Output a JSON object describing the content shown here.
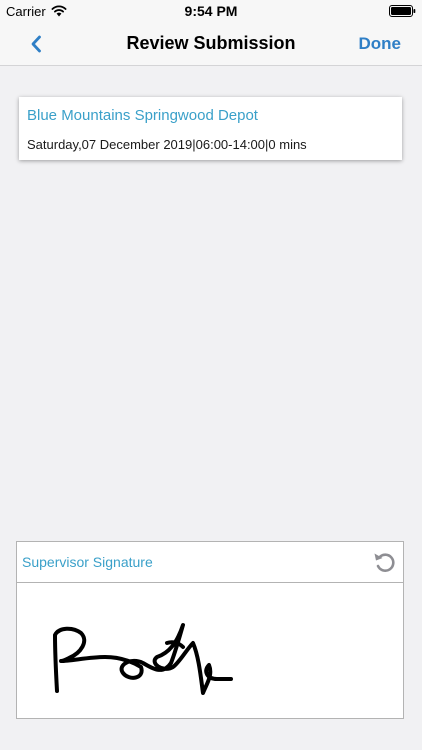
{
  "status_bar": {
    "carrier": "Carrier",
    "time": "9:54 PM",
    "wifi_icon": "wifi-icon",
    "battery_icon": "battery-full-icon"
  },
  "nav": {
    "back_icon": "chevron-left-icon",
    "title": "Review Submission",
    "done_label": "Done"
  },
  "shift": {
    "location": "Blue Mountains Springwood Depot",
    "details": "Saturday,07 December 2019|06:00-14:00|0 mins"
  },
  "signature": {
    "label": "Supervisor Signature",
    "reset_icon": "undo-icon",
    "signature_image": "handwritten-signature"
  },
  "colors": {
    "accent_blue": "#2f7fc6",
    "label_teal": "#3aa0c9",
    "background": "#f1f1f3"
  }
}
